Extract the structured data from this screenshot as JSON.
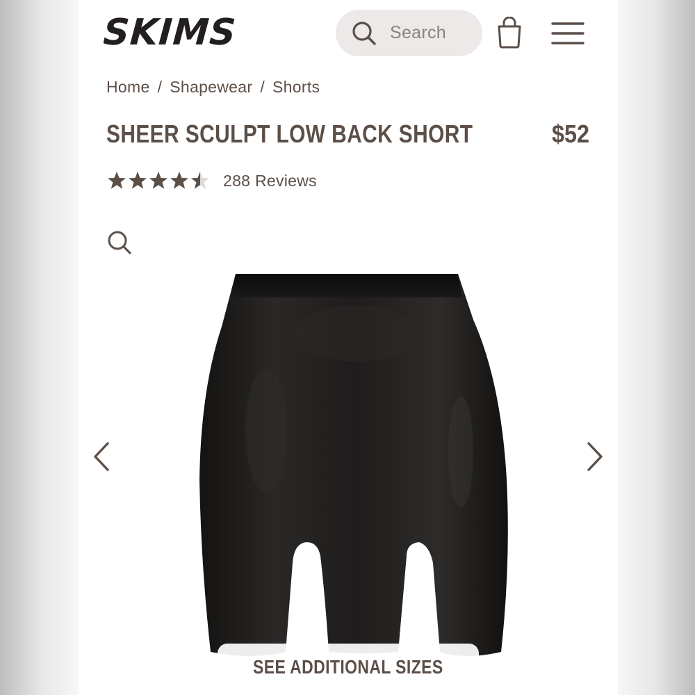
{
  "header": {
    "logo_text": "SKIMS",
    "search_placeholder": "Search",
    "search_icon": "search-icon",
    "bag_icon": "shopping-bag-icon",
    "menu_icon": "hamburger-menu-icon"
  },
  "breadcrumb": {
    "items": [
      "Home",
      "Shapewear",
      "Shorts"
    ],
    "separator": "/"
  },
  "product": {
    "title": "SHEER SCULPT LOW BACK SHORT",
    "price": "$52",
    "rating": 4.5,
    "rating_max": 5,
    "reviews_label": "288 Reviews",
    "zoom_icon": "zoom-icon",
    "image_color": "#1c1a19",
    "see_sizes_label": "SEE ADDITIONAL SIZES"
  },
  "carousel": {
    "prev_icon": "chevron-left-icon",
    "next_icon": "chevron-right-icon"
  },
  "colors": {
    "text": "#5b4f48",
    "search_bg": "#ece9e8",
    "star": "#5b4f48",
    "star_empty": "#dcdad9"
  }
}
